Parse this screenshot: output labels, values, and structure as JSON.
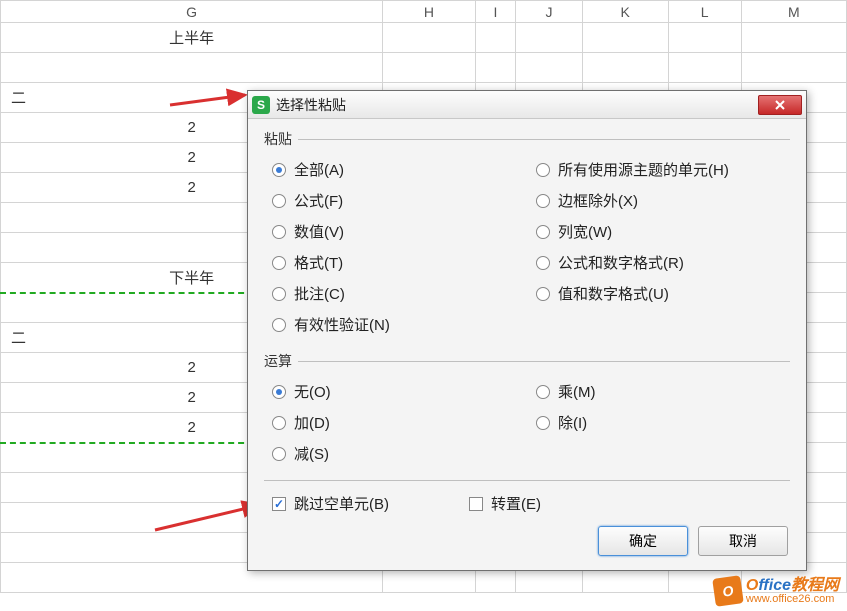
{
  "columns": [
    "G",
    "H",
    "I",
    "J",
    "K",
    "L",
    "M"
  ],
  "cells": {
    "r1c1": "上半年",
    "r3c1": "二",
    "r4c1": "2",
    "r5c1": "2",
    "r6c1": "2",
    "r9c1": "下半年",
    "r11c1": "二",
    "r12c1": "2",
    "r13c1": "2",
    "r14c1": "2"
  },
  "dialog": {
    "title": "选择性粘贴",
    "paste_legend": "粘贴",
    "paste_options": {
      "all": "全部(A)",
      "formulas": "公式(F)",
      "values": "数值(V)",
      "formats": "格式(T)",
      "comments": "批注(C)",
      "validation": "有效性验证(N)",
      "theme": "所有使用源主题的单元(H)",
      "noborder": "边框除外(X)",
      "colwidth": "列宽(W)",
      "formnum": "公式和数字格式(R)",
      "valnum": "值和数字格式(U)"
    },
    "op_legend": "运算",
    "op_options": {
      "none": "无(O)",
      "add": "加(D)",
      "sub": "减(S)",
      "mul": "乘(M)",
      "div": "除(I)"
    },
    "skip_blanks": "跳过空单元(B)",
    "transpose": "转置(E)",
    "ok": "确定",
    "cancel": "取消"
  },
  "watermark": {
    "brand": "Office教程网",
    "url": "www.office26.com"
  }
}
